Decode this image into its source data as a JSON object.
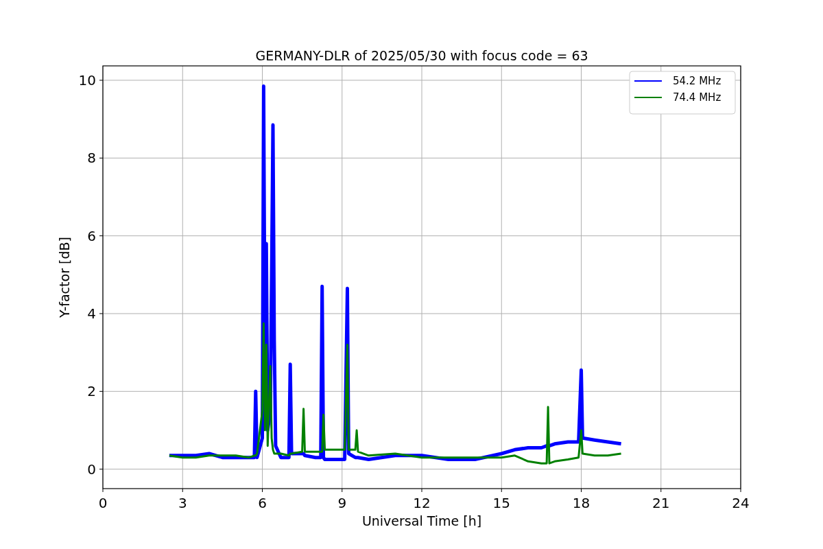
{
  "chart": {
    "chart_data": {
      "type": "line",
      "title": "GERMANY-DLR of 2025/05/30 with focus code = 63",
      "xlabel": "Universal Time [h]",
      "ylabel": "Y-factor [dB]",
      "x": [
        2.5,
        3,
        3.5,
        4,
        4.5,
        5,
        5.5,
        5.7,
        5.75,
        5.8,
        6.0,
        6.05,
        6.1,
        6.15,
        6.2,
        6.3,
        6.35,
        6.4,
        6.45,
        6.5,
        6.7,
        7.0,
        7.05,
        7.1,
        7.5,
        7.55,
        7.6,
        8.0,
        8.2,
        8.25,
        8.3,
        8.35,
        9.1,
        9.2,
        9.25,
        9.5,
        9.55,
        9.6,
        10,
        11,
        12,
        13,
        14,
        15,
        15.5,
        16,
        16.5,
        16.7,
        16.75,
        16.8,
        17,
        17.5,
        17.9,
        18,
        18.05,
        18.5,
        19,
        19.5
      ],
      "series": [
        {
          "name": "54.2 MHz",
          "color": "#0000ff",
          "values": [
            0.35,
            0.35,
            0.35,
            0.4,
            0.3,
            0.3,
            0.3,
            0.3,
            2.0,
            0.3,
            0.8,
            9.85,
            2.5,
            5.8,
            1.0,
            1.5,
            5.0,
            8.85,
            3.3,
            0.6,
            0.3,
            0.3,
            2.7,
            0.4,
            0.4,
            0.4,
            0.35,
            0.3,
            0.3,
            4.7,
            0.3,
            0.25,
            0.25,
            4.65,
            0.4,
            0.3,
            0.3,
            0.3,
            0.25,
            0.35,
            0.35,
            0.25,
            0.25,
            0.4,
            0.5,
            0.55,
            0.55,
            0.6,
            0.6,
            0.6,
            0.65,
            0.7,
            0.7,
            2.55,
            0.8,
            0.75,
            0.7,
            0.65
          ]
        },
        {
          "name": "74.4 MHz",
          "color": "#008000",
          "values": [
            0.35,
            0.3,
            0.3,
            0.35,
            0.35,
            0.35,
            0.3,
            0.35,
            0.35,
            0.4,
            1.5,
            3.75,
            1.0,
            3.2,
            0.6,
            2.65,
            0.8,
            0.5,
            0.4,
            0.4,
            0.4,
            0.35,
            0.4,
            0.4,
            0.45,
            1.55,
            0.45,
            0.45,
            0.45,
            0.45,
            1.4,
            0.5,
            0.5,
            3.2,
            0.5,
            0.5,
            1.0,
            0.45,
            0.35,
            0.4,
            0.3,
            0.3,
            0.3,
            0.3,
            0.35,
            0.2,
            0.15,
            0.15,
            1.6,
            0.15,
            0.2,
            0.25,
            0.3,
            1.0,
            0.4,
            0.35,
            0.35,
            0.4
          ]
        }
      ],
      "grid": true,
      "legend": true,
      "xlim": [
        0,
        24
      ],
      "ylim": [
        -0.5,
        10.37
      ],
      "xticks": [
        0,
        3,
        6,
        9,
        12,
        15,
        18,
        21,
        24
      ],
      "yticks": [
        0,
        2,
        4,
        6,
        8,
        10
      ]
    }
  }
}
